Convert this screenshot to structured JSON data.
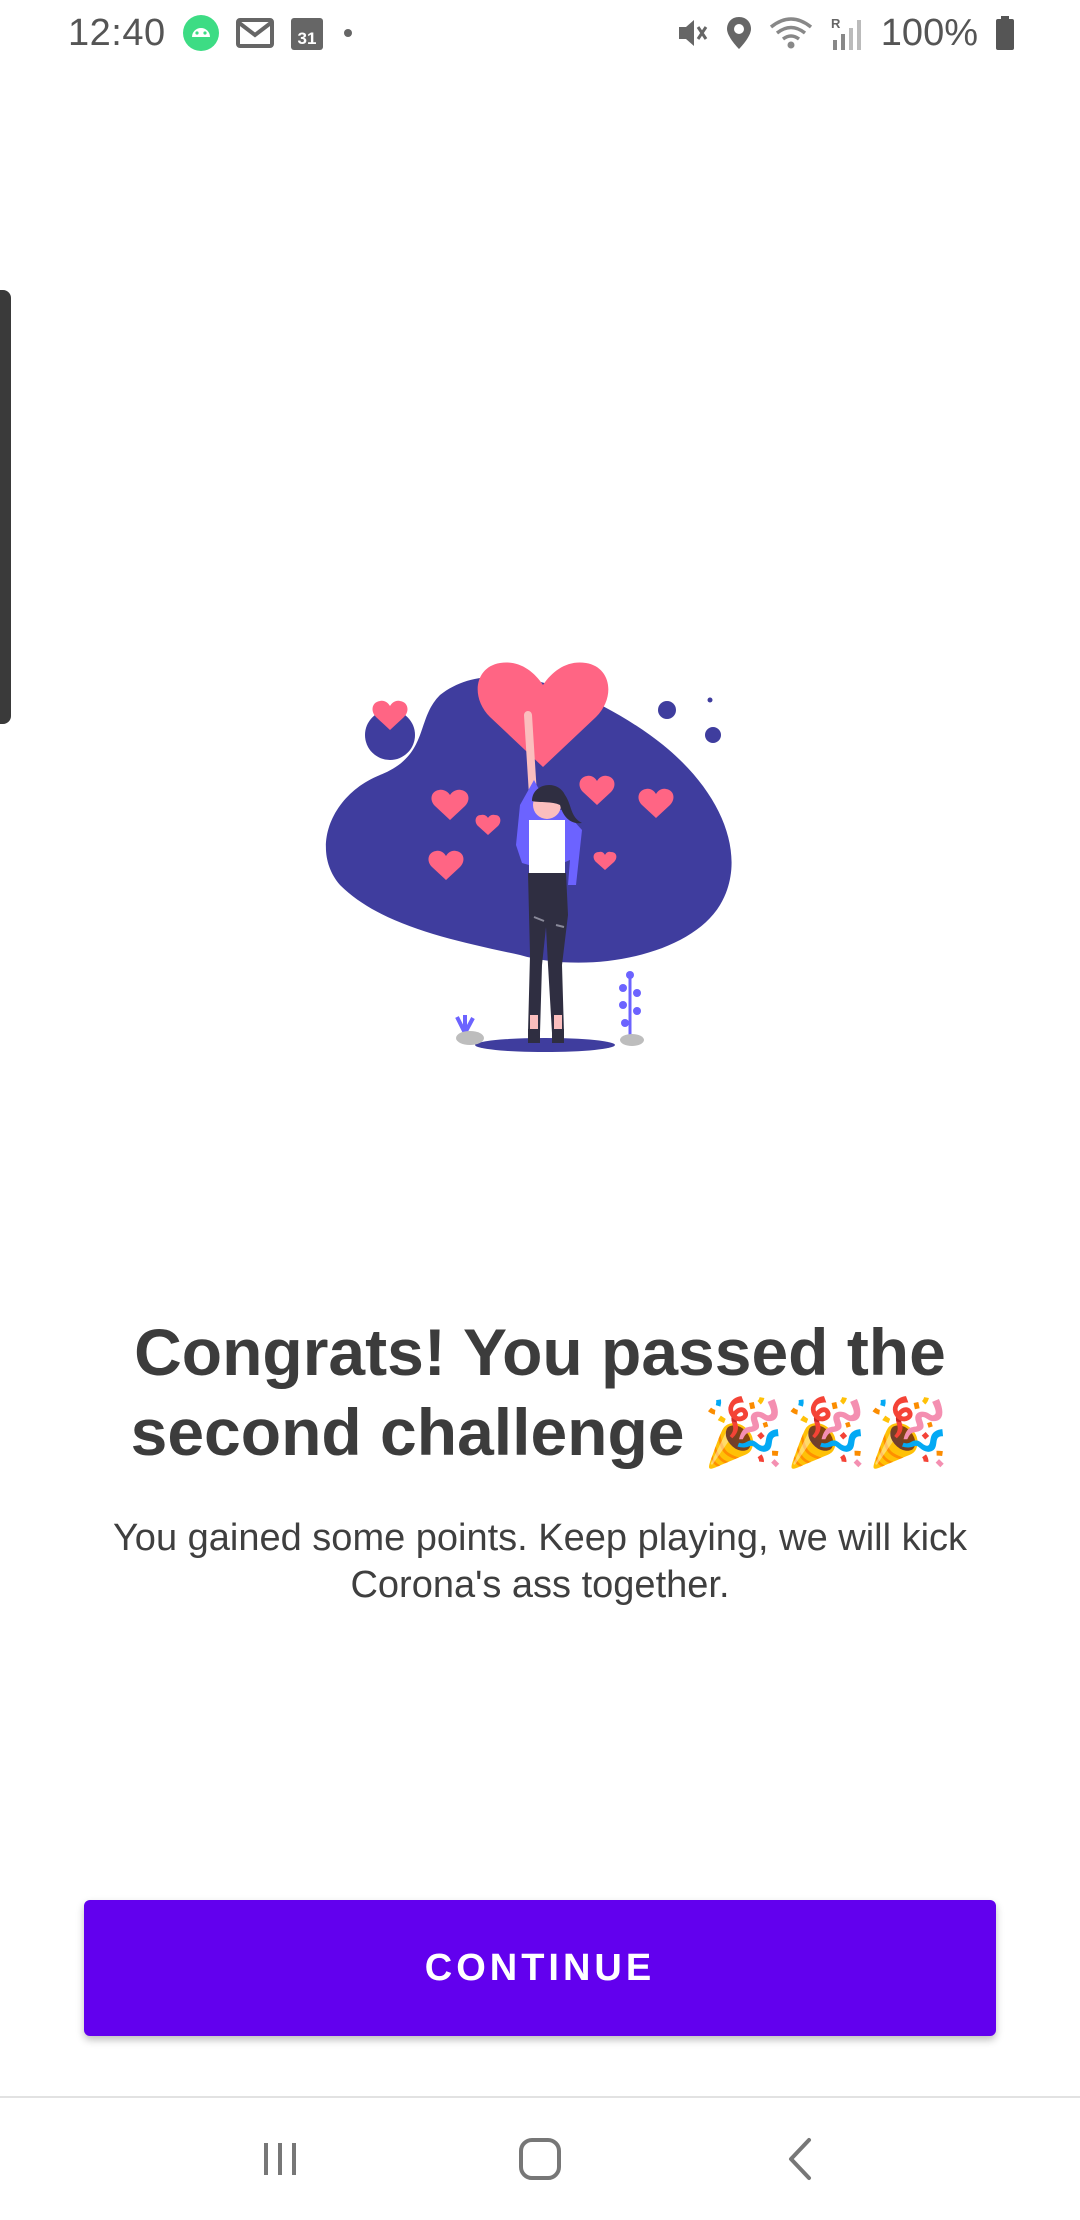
{
  "status_bar": {
    "time": "12:40",
    "battery_percent": "100%",
    "left_icons": [
      "android-notification-icon",
      "gmail-icon",
      "calendar-icon",
      "more-notifications-dot-icon"
    ],
    "calendar_day": "31",
    "right_icons": [
      "vibrate-icon",
      "location-icon",
      "wifi-icon",
      "signal-roaming-icon",
      "battery-icon"
    ]
  },
  "illustration": {
    "description_icon": "celebration-woman-hearts-illustration",
    "colors": {
      "blob": "#3f3d9e",
      "heart": "#ff6584",
      "jacket": "#6c63ff",
      "pants": "#2f2e41"
    }
  },
  "main": {
    "title": "Congrats! You passed the second challenge 🎉🎉🎉",
    "subtitle": "You gained some points. Keep playing, we will kick Corona's ass together."
  },
  "actions": {
    "continue_label": "CONTINUE",
    "button_color": "#6200ee"
  },
  "nav_bar": {
    "items": [
      "recent-apps",
      "home",
      "back"
    ]
  }
}
